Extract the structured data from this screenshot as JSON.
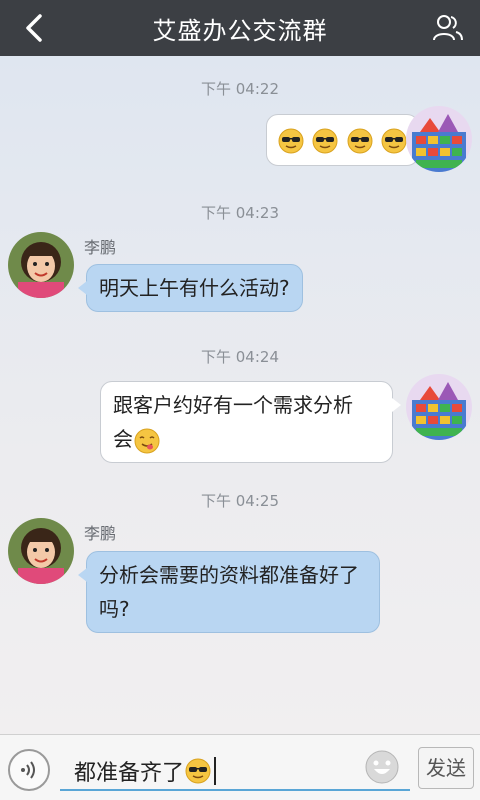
{
  "header": {
    "title": "艾盛办公交流群",
    "back_icon": "chevron-left-icon",
    "members_icon": "group-members-icon"
  },
  "messages": [
    {
      "time": "下午 04:22",
      "direction": "out",
      "text": "",
      "emojis": [
        "sunglasses",
        "sunglasses",
        "sunglasses",
        "sunglasses"
      ]
    },
    {
      "time": "下午 04:23",
      "direction": "in",
      "sender": "李鹏",
      "text": "明天上午有什么活动?"
    },
    {
      "time": "下午 04:24",
      "direction": "out",
      "text_line1": "跟客户约好有一个需求分析",
      "text_line2": "会",
      "emoji": "yum"
    },
    {
      "time": "下午 04:25",
      "direction": "in",
      "sender": "李鹏",
      "text_line1": "分析会需要的资料都准备好了",
      "text_line2": "吗?"
    }
  ],
  "input": {
    "value": "都准备齐了",
    "voice_icon": "voice-icon",
    "emoji_icon": "smiley-icon",
    "send_label": "发送"
  },
  "colors": {
    "header_bg": "#3c3f44",
    "incoming_bubble": "#b9d6f2",
    "outgoing_bubble": "#ffffff",
    "input_underline": "#5aa6d6"
  }
}
